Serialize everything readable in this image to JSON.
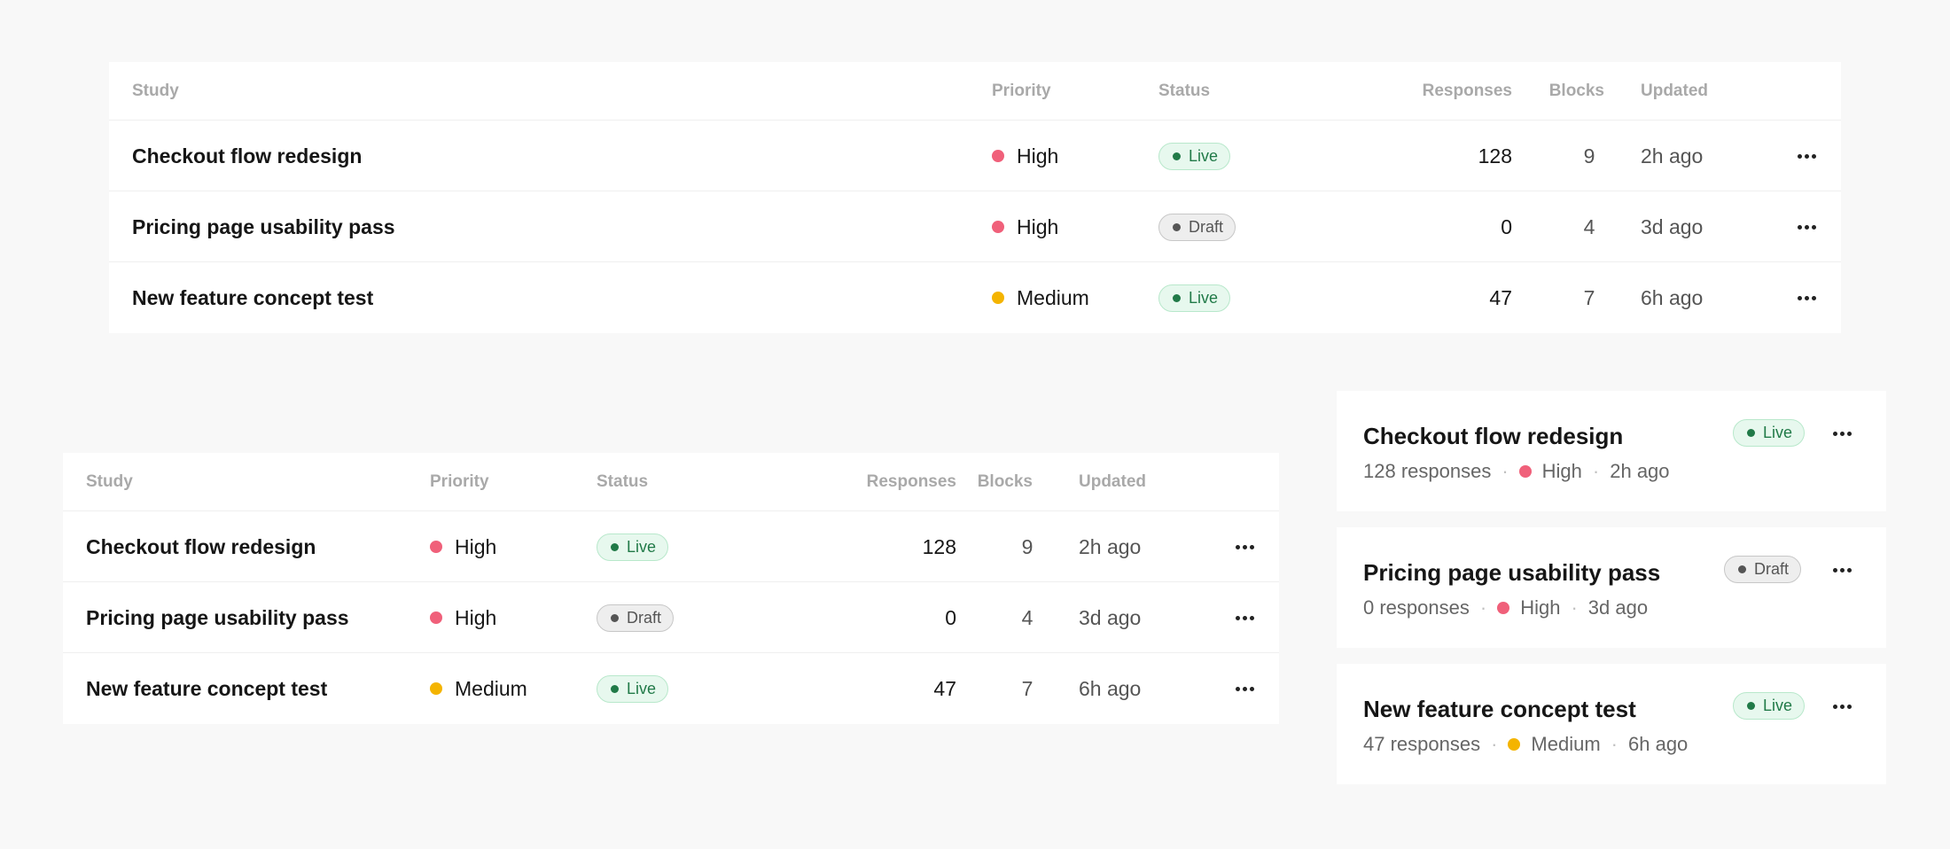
{
  "columns": {
    "study": "Study",
    "priority": "Priority",
    "status": "Status",
    "responses": "Responses",
    "blocks": "Blocks",
    "updated": "Updated"
  },
  "rows": [
    {
      "name": "Checkout flow redesign",
      "priority": "High",
      "priority_color": "#f0607a",
      "status": "Live",
      "responses": "128",
      "blocks": "9",
      "updated": "2h ago"
    },
    {
      "name": "Pricing page usability pass",
      "priority": "High",
      "priority_color": "#f0607a",
      "status": "Draft",
      "responses": "0",
      "blocks": "4",
      "updated": "3d ago"
    },
    {
      "name": "New feature concept test",
      "priority": "Medium",
      "priority_color": "#f4b400",
      "status": "Live",
      "responses": "47",
      "blocks": "7",
      "updated": "6h ago"
    }
  ],
  "cards": [
    {
      "name": "Checkout flow redesign",
      "responses_text": "128 responses",
      "priority": "High",
      "priority_color": "#f0607a",
      "status": "Live",
      "updated": "2h ago"
    },
    {
      "name": "Pricing page usability pass",
      "responses_text": "0 responses",
      "priority": "High",
      "priority_color": "#f0607a",
      "status": "Draft",
      "updated": "3d ago"
    },
    {
      "name": "New feature concept test",
      "responses_text": "47 responses",
      "priority": "Medium",
      "priority_color": "#f4b400",
      "status": "Live",
      "updated": "6h ago"
    }
  ],
  "colors": {
    "live_bg": "#e7f8ee",
    "live_text": "#217a48",
    "draft_bg": "#eeeeee",
    "draft_text": "#555555",
    "high": "#f0607a",
    "medium": "#f4b400"
  },
  "icons": {
    "row_menu": "more-horizontal-icon"
  }
}
